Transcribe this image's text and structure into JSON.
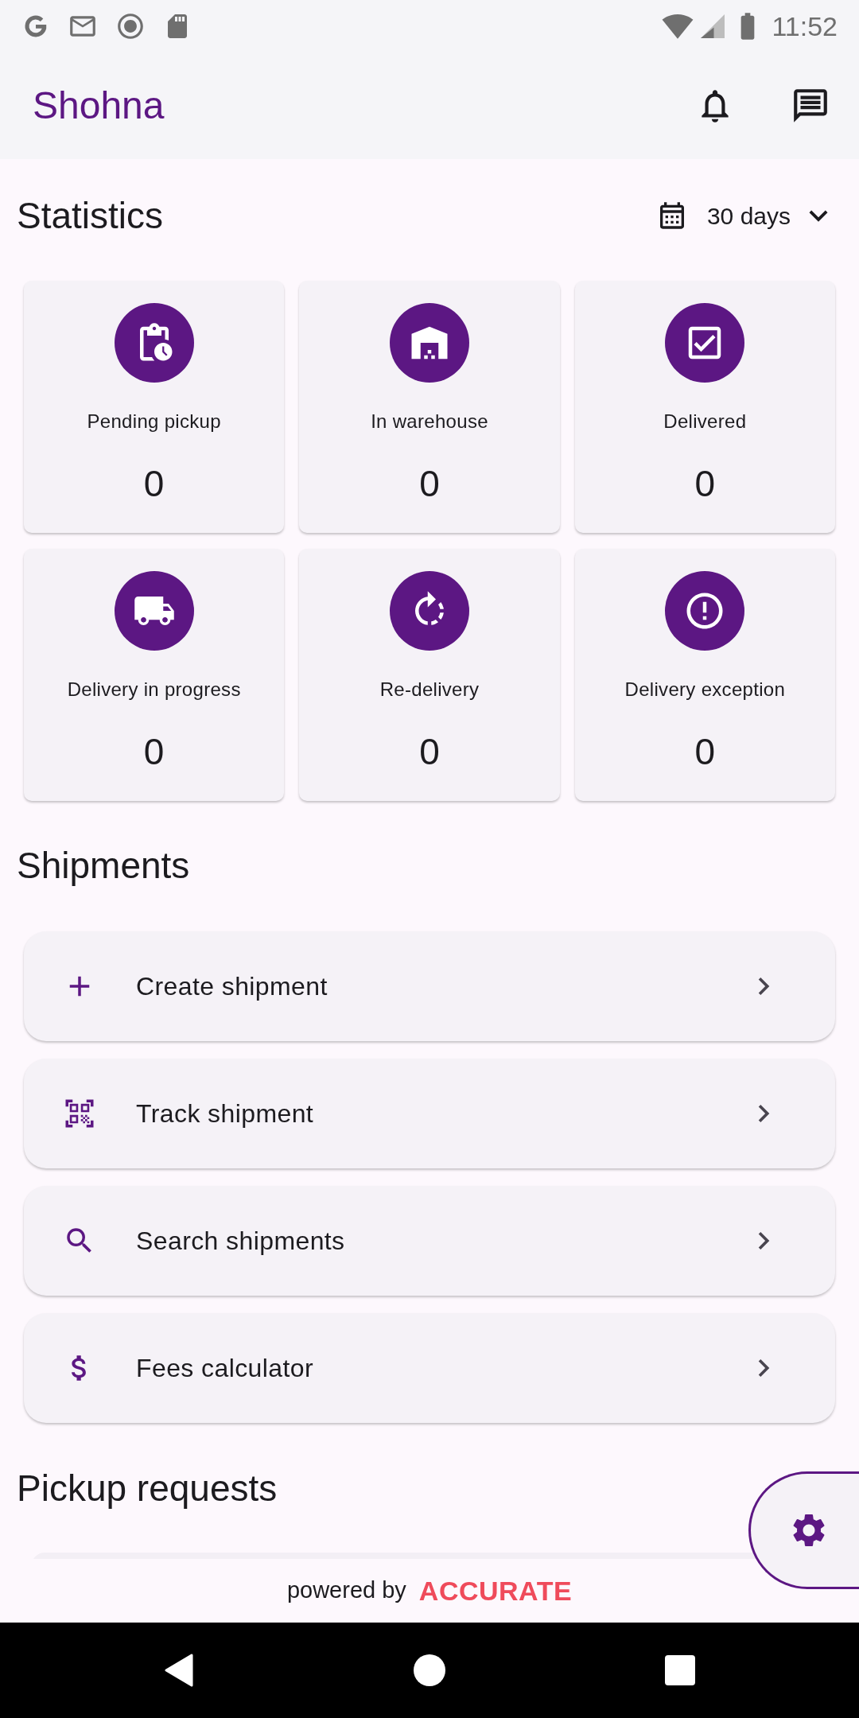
{
  "status_bar": {
    "time": "11:52"
  },
  "app_bar": {
    "title": "Shohna"
  },
  "statistics": {
    "title": "Statistics",
    "period": "30 days",
    "cards": [
      {
        "kind": "pending",
        "label": "Pending pickup",
        "count": "0"
      },
      {
        "kind": "warehouse",
        "label": "In warehouse",
        "count": "0"
      },
      {
        "kind": "delivered",
        "label": "Delivered",
        "count": "0"
      },
      {
        "kind": "in_progress",
        "label": "Delivery in progress",
        "count": "0"
      },
      {
        "kind": "redelivery",
        "label": "Re-delivery",
        "count": "0"
      },
      {
        "kind": "exception",
        "label": "Delivery exception",
        "count": "0"
      }
    ]
  },
  "shipments": {
    "title": "Shipments",
    "items": [
      {
        "kind": "create",
        "label": "Create shipment"
      },
      {
        "kind": "track",
        "label": "Track shipment"
      },
      {
        "kind": "search",
        "label": "Search shipments"
      },
      {
        "kind": "fees",
        "label": "Fees calculator"
      }
    ]
  },
  "pickup_requests": {
    "title": "Pickup requests"
  },
  "footer": {
    "prefix": "powered by",
    "brand": "ACCURATE"
  }
}
